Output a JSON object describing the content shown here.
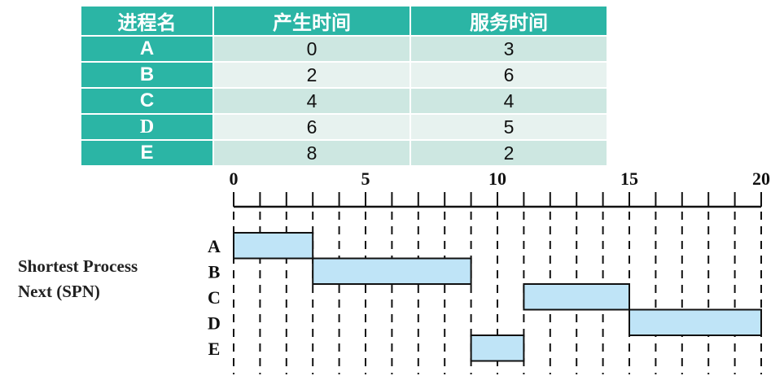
{
  "table": {
    "headers": [
      "进程名",
      "产生时间",
      "服务时间"
    ],
    "rows": [
      {
        "name": "A",
        "arrival": "0",
        "service": "3"
      },
      {
        "name": "B",
        "arrival": "2",
        "service": "6"
      },
      {
        "name": "C",
        "arrival": "4",
        "service": "4"
      },
      {
        "name": "D",
        "arrival": "6",
        "service": "5"
      },
      {
        "name": "E",
        "arrival": "8",
        "service": "2"
      }
    ]
  },
  "policy": {
    "line1": "Shortest Process",
    "line2": "Next (SPN)"
  },
  "chart_data": {
    "type": "gantt",
    "time_range": [
      0,
      20
    ],
    "tick_labels": [
      "0",
      "5",
      "10",
      "15",
      "20"
    ],
    "processes": [
      "A",
      "B",
      "C",
      "D",
      "E"
    ],
    "bars": [
      {
        "process": "A",
        "start": 0,
        "end": 3
      },
      {
        "process": "B",
        "start": 3,
        "end": 9
      },
      {
        "process": "C",
        "start": 11,
        "end": 15
      },
      {
        "process": "D",
        "start": 15,
        "end": 20
      },
      {
        "process": "E",
        "start": 9,
        "end": 11
      }
    ],
    "bar_color": "#bfe4f7",
    "header_color": "#2bb5a5"
  }
}
